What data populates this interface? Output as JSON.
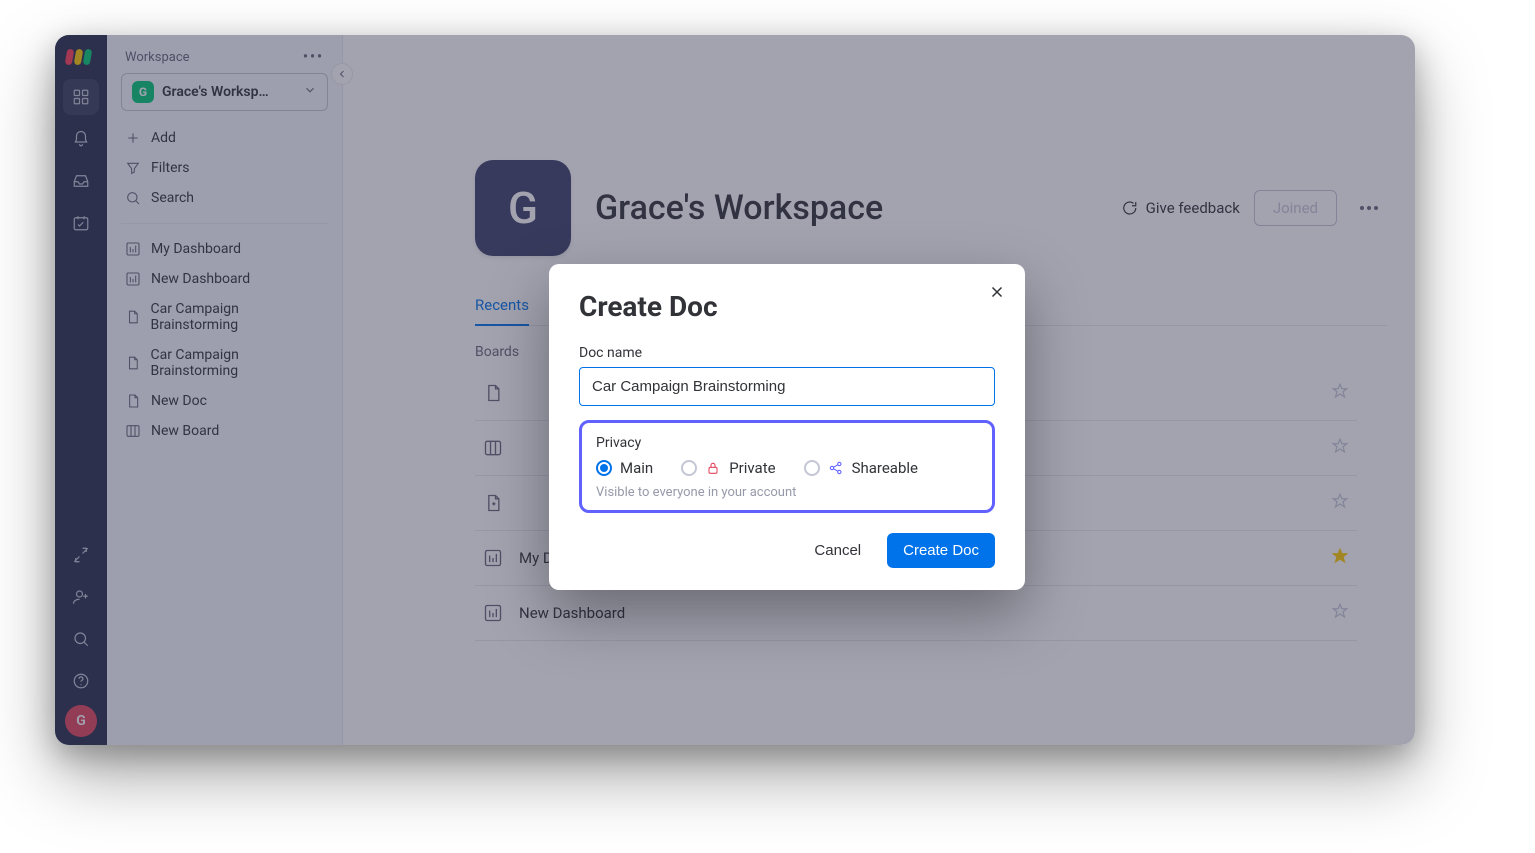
{
  "rail": {
    "avatar_letter": "G"
  },
  "sidebar": {
    "section_title": "Workspace",
    "workspace_badge": "G",
    "workspace_name": "Grace's Worksp…",
    "actions": {
      "add": "Add",
      "filters": "Filters",
      "search": "Search"
    },
    "items": [
      {
        "label": "My Dashboard",
        "icon": "dashboard"
      },
      {
        "label": "New Dashboard",
        "icon": "dashboard"
      },
      {
        "label": "Car Campaign Brainstorming",
        "icon": "doc"
      },
      {
        "label": "Car Campaign Brainstorming",
        "icon": "doc"
      },
      {
        "label": "New Doc",
        "icon": "doc"
      },
      {
        "label": "New Board",
        "icon": "board"
      }
    ]
  },
  "main": {
    "tile_letter": "G",
    "title": "Grace's Workspace",
    "feedback": "Give feedback",
    "joined": "Joined",
    "tabs": {
      "recents": "Recents"
    },
    "section_label": "Boards",
    "rows": [
      {
        "name": "",
        "icon": "doc",
        "starred": false
      },
      {
        "name": "",
        "icon": "board",
        "starred": false
      },
      {
        "name": "",
        "icon": "doc-add",
        "starred": false
      },
      {
        "name": "My Dashboard",
        "icon": "dashboard",
        "starred": true
      },
      {
        "name": "New Dashboard",
        "icon": "dashboard",
        "starred": false
      }
    ]
  },
  "modal": {
    "title": "Create Doc",
    "name_label": "Doc name",
    "name_value": "Car Campaign Brainstorming",
    "privacy_label": "Privacy",
    "options": {
      "main": "Main",
      "private": "Private",
      "shareable": "Shareable"
    },
    "hint": "Visible to everyone in your account",
    "cancel": "Cancel",
    "submit": "Create Doc"
  }
}
